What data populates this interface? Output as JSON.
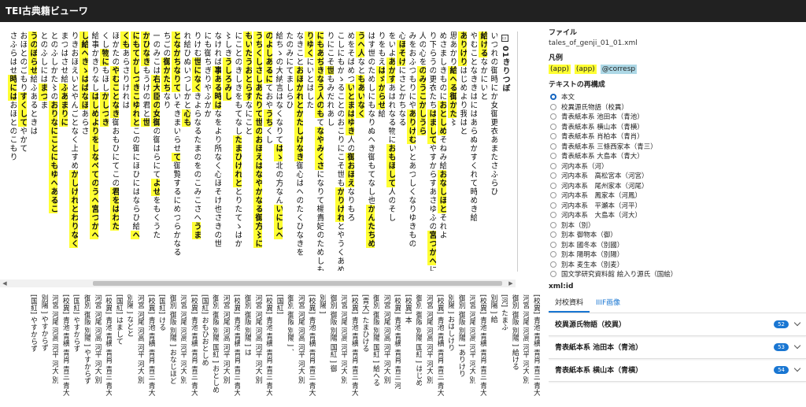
{
  "app": {
    "title": "TEI古典籍ビューワ"
  },
  "reader": {
    "chapter_title": "01きりつぼ",
    "columns": [
      [
        [
          "いつれの御時にか女御更衣あまたさふらひ",
          "n"
        ]
      ],
      [
        [
          "給ける",
          "h"
        ],
        [
          "なかにいと",
          "n"
        ]
      ],
      [
        [
          "やむことなききはにはあらぬかすくれて時めき給",
          "n"
        ]
      ],
      [
        [
          "ありけり",
          "h"
        ],
        [
          "はじめより我はと",
          "n"
        ]
      ],
      [
        [
          "思あかり",
          "n"
        ],
        [
          "給へる",
          "h"
        ],
        [
          "御かた",
          "h"
        ],
        [
          "〻",
          "n"
        ]
      ],
      [
        [
          "めさましきものに",
          "n"
        ],
        [
          "おとしめ",
          "h"
        ],
        [
          "そねみ給",
          "n"
        ],
        [
          "おなしほと",
          "h"
        ],
        [
          "それよ",
          "n"
        ]
      ],
      [
        [
          "り下らうの更衣たち",
          "n"
        ],
        [
          "はまして",
          "h"
        ],
        [
          "やすからすあさゆふの",
          "n"
        ],
        [
          "宮つかへ",
          "h"
        ],
        [
          "に",
          "n"
        ],
        [
          "つけても",
          "h"
        ]
      ],
      [
        [
          "人の心を",
          "n"
        ],
        [
          "のみ",
          "h"
        ],
        [
          "うこかし",
          "h"
        ],
        [
          "うら",
          "h"
        ]
      ],
      [
        [
          "みをおふつもりにや",
          "n"
        ],
        [
          "ありけむ",
          "h"
        ],
        [
          "いとあつしくなりゆき",
          "n"
        ],
        [
          "もの",
          "n"
        ]
      ],
      [
        [
          "心",
          "n"
        ],
        [
          "ほそけ",
          "h"
        ],
        [
          "にさとかちなる",
          "n"
        ]
      ],
      [
        [
          "をいよ",
          "n"
        ],
        [
          "あかす",
          "h"
        ],
        [
          "あはれなる物に",
          "n"
        ],
        [
          "おもほして",
          "h"
        ],
        [
          "人",
          "n"
        ],
        [
          "のそし",
          "n"
        ]
      ],
      [
        [
          "りをもえ",
          "n"
        ],
        [
          "はゞからせ",
          "h"
        ],
        [
          "給",
          "n"
        ]
      ],
      [
        [
          "はす世のためしにもなりぬへき御もてなし也",
          "n"
        ],
        [
          "かんたちめ",
          "h"
        ]
      ],
      [
        [
          "うへ人",
          "h"
        ],
        [
          "なと",
          "n"
        ],
        [
          "もあいなく",
          "h"
        ]
      ],
      [
        [
          "めをそばめつ",
          "n"
        ],
        [
          "いとまはゆき",
          "h"
        ],
        [
          "人の",
          "n"
        ],
        [
          "御",
          "h"
        ],
        [
          "おほえ",
          "h"
        ],
        [
          "なりもろ",
          "n"
        ]
      ],
      [
        [
          "こしにもかゝることのおこりにこそ世も",
          "n"
        ],
        [
          "かりけれ",
          "h"
        ],
        [
          "とやうくあめのした",
          "n"
        ]
      ],
      [
        [
          "りにこそ",
          "n"
        ],
        [
          "世",
          "h"
        ],
        [
          "もみだれあし",
          "n"
        ]
      ],
      [
        [
          "にもあぢきなう人のも",
          "h"
        ],
        [
          "て",
          "n"
        ],
        [
          "なやみくさ",
          "h"
        ],
        [
          "になりて楊貴妃のためしもひきいてつへく",
          "n"
        ],
        [
          "な",
          "h"
        ]
      ],
      [
        [
          "りゆく",
          "h"
        ],
        [
          "にいとはした",
          "n"
        ]
      ],
      [
        [
          "なきこと",
          "n"
        ],
        [
          "おほかれと",
          "h"
        ],
        [
          "かたしけなき",
          "h"
        ],
        [
          "御心はへのたくひなきを",
          "n"
        ]
      ],
      [
        [
          "たのみにてましらひ",
          "n"
        ]
      ],
      [
        [
          "給",
          "n"
        ],
        [
          "ちゝの大納言はなくなりて",
          "n"
        ],
        [
          "はゝ",
          "h"
        ],
        [
          "北の方なん",
          "n"
        ],
        [
          "いにしへ",
          "h"
        ]
      ],
      [
        [
          "のよしあるに",
          "h"
        ],
        [
          "て",
          "n"
        ],
        [
          "おや",
          "n"
        ],
        [
          "うち",
          "h"
        ],
        [
          "くし",
          "n"
        ]
      ],
      [
        [
          "うちくしさしあたりて世のおほえはなやか",
          "h"
        ],
        [
          "なる御方〻に",
          "h"
        ]
      ],
      [
        [
          "もいたう",
          "h"
        ],
        [
          "おとらす",
          "h"
        ],
        [
          "なにこと",
          "n"
        ]
      ],
      [
        [
          "にことのきしきをもてなし",
          "n"
        ],
        [
          "たまひけれと",
          "h"
        ],
        [
          "とりたてゝはか",
          "n"
        ]
      ],
      [
        [
          "〻しき",
          "n"
        ],
        [
          "うしろみし",
          "h"
        ]
      ],
      [
        [
          "なければ",
          "n"
        ],
        [
          "事ある時は",
          "h"
        ],
        [
          "なをより所なく心ほそけ也さきの世",
          "n"
        ]
      ],
      [
        [
          "にも御ちぎりやふかか",
          "n"
        ]
      ],
      [
        [
          "りけむ",
          "n"
        ],
        [
          "世になく",
          "h"
        ],
        [
          "きよらなるたまのをのこみこさへ",
          "n"
        ],
        [
          "うま",
          "h"
        ]
      ],
      [
        [
          "れ給ひぬいつしかと",
          "n"
        ],
        [
          "心も",
          "h"
        ]
      ],
      [
        [
          "となかちなりて",
          "h"
        ],
        [
          "いそきまいらせ",
          "n"
        ],
        [
          "て",
          "h"
        ],
        [
          "御覧するにめつらかなる",
          "n"
        ]
      ],
      [
        [
          "ちごの",
          "n"
        ],
        [
          "御かたち",
          "h"
        ],
        [
          "なり",
          "n"
        ]
      ],
      [
        [
          "一のみこは",
          "n"
        ],
        [
          "右大臣の女御",
          "h"
        ],
        [
          "の御はらにて",
          "n"
        ],
        [
          "よせ",
          "h"
        ],
        [
          "をもくうた",
          "n"
        ]
      ],
      [
        [
          "かひなき",
          "h"
        ],
        [
          "もうけの君と",
          "n"
        ],
        [
          "世",
          "h"
        ]
      ],
      [
        [
          "にもてかしつき",
          "h"
        ],
        [
          "こゆれと",
          "h"
        ],
        [
          "この御にほひにはならひ給",
          "n"
        ],
        [
          "へ",
          "h"
        ]
      ],
      [
        [
          "くも",
          "h"
        ],
        [
          "あらさりけれは",
          "n"
        ]
      ],
      [
        [
          "ほかたの",
          "n"
        ],
        [
          "やむことなき",
          "h"
        ],
        [
          "御おもひにてこの",
          "n"
        ],
        [
          "君をはわた",
          "h"
        ]
      ],
      [
        [
          "くし",
          "n"
        ],
        [
          "物に",
          "h"
        ],
        [
          "もほし",
          "n"
        ],
        [
          "かしつき",
          "h"
        ]
      ],
      [
        [
          "給事かきりなし",
          "n"
        ],
        [
          "はしめより",
          "h"
        ],
        [
          "をしなべての",
          "h"
        ],
        [
          "うへ宮つかへ",
          "h"
        ]
      ],
      [
        [
          "し給へき",
          "h"
        ],
        [
          "ゝはばなほ",
          "h"
        ],
        [
          "あらさ",
          "n"
        ]
      ],
      [
        [
          "りきおほえいとやんごとなく上すめ",
          "n"
        ],
        [
          "かしけれとわりなく",
          "h"
        ]
      ],
      [
        [
          "まつはさせ給",
          "n"
        ],
        [
          "ふあまりに",
          "h"
        ]
      ],
      [
        [
          "とのふしかた〻の",
          "n"
        ],
        [
          "おり",
          "h"
        ],
        [
          "なにことにも",
          "h"
        ],
        [
          "ゆへある",
          "h"
        ],
        [
          "こ",
          "h"
        ]
      ],
      [
        [
          "とのふしには",
          "n"
        ],
        [
          "まつ",
          "h"
        ],
        [
          "ま",
          "n"
        ]
      ],
      [
        [
          "うのぼらせ",
          "h"
        ],
        [
          "給ふあるときは",
          "n"
        ]
      ],
      [
        [
          "おほとのごもり",
          "n"
        ],
        [
          "すくして",
          "h"
        ],
        [
          "やかて",
          "n"
        ]
      ],
      [
        [
          "さふらはせ",
          "n"
        ],
        [
          "時には",
          "h"
        ],
        [
          "おほとのこもり",
          "n"
        ]
      ]
    ]
  },
  "variants": {
    "columns": [
      "[校異] 青池 青横 青肖 青三 青大",
      "河宮 河尾 河高 河平 河大 別",
      "御別 御阪 別陽 ] 給ける",
      "[河] たまふ",
      "別陽 ] 給",
      "[校異] 青池 青横 青肖 青三 青大",
      "河宮 河尾 河高 河平 河大 別",
      "御別 御阪 別陽 ] ありけり",
      "別陽 ] おはしけり",
      "[校異] 青池 青横 青肖 青三 青大",
      "河宮 河尾 河高 河平 河大 別",
      "御別 御阪 別陽 国紅 ] はじめ",
      "[校異] 本",
      "[校異] 青池 青横 青肖 青三 河",
      "河宮 河尾 河高 河平 河大 別",
      "御別 御阪 別陽 国紅 ] 給へる",
      "[青大] たまひける",
      "[校異] 青池 青横 青肖 青三 青大",
      "河宮 河尾 河高 河平 河大 別",
      "御別 御阪 別陽 国紅 ] 御",
      "別陽 ]",
      "[校異] 青池 青横 青肖 青三 青大",
      "河宮 河尾 河高 河平 河大 別",
      "御別 御阪 別陽 ] 、",
      "[国紅]",
      "[校異] 青池 青横 青肖 青三 青大",
      "河宮 河尾 河高 河平 河大 別",
      "御別 御阪 別陽 ] は",
      "[校異] 青池 青横 青肖 青三 青大",
      "河宮 河尾 河高 河平 河大 別",
      "御別 御阪 別陽 国紅 ] おとしめ",
      "[国紅] おもひおとしめ",
      "[校異] 青池 青横 青肖 青三 青大",
      "河宮 河尾 河高 河平 河大 別",
      "御別 御阪 別陽 ] おなじほど",
      "[国紅] ける",
      "[校異] 青池 青横 青肖 青三 青大",
      "河宮 河尾 河高 河平 河大 別",
      "別陽 ] などと",
      "[国紅] はまして",
      "[校異] 青池 青横 青肖 青三 青大",
      "河宮 河尾 河高 河平 河大 別",
      "御別 御阪 別陽 ] やすからず",
      "[国紅] やすからず",
      "[校異] 青池 青横 青肖 青三 青大",
      "河宮 河尾 河高 河平 河大 別",
      "別陽 ] やすからず",
      "[国紅] やすからず"
    ]
  },
  "side": {
    "file_heading": "ファイル",
    "file_name": "tales_of_genji_01_01.xml",
    "legend_heading": "凡例",
    "legend": [
      "(app)",
      "(app)",
      "@corresp"
    ],
    "reconstruct_heading": "テキストの再構成",
    "options": [
      {
        "label": "本文",
        "checked": true
      },
      {
        "label": "校異源氏物語（校異）",
        "checked": false
      },
      {
        "label": "青表紙本系 池田本（青池）",
        "checked": false
      },
      {
        "label": "青表紙本系 横山本（青横）",
        "checked": false
      },
      {
        "label": "青表紙本系 肖柏本（青肖）",
        "checked": false
      },
      {
        "label": "青表紙本系 三條西家本（青三）",
        "checked": false
      },
      {
        "label": "青表紙本系 大島本（青大）",
        "checked": false
      },
      {
        "label": "河内本系（河）",
        "checked": false
      },
      {
        "label": "河内本系　高松宮本（河宮）",
        "checked": false
      },
      {
        "label": "河内本系　尾州家本（河尾）",
        "checked": false
      },
      {
        "label": "河内本系　鳳家本（河鳳）",
        "checked": false
      },
      {
        "label": "河内本系　平瀬本（河平）",
        "checked": false
      },
      {
        "label": "河内本系　大島本（河大）",
        "checked": false
      },
      {
        "label": "別本（別）",
        "checked": false
      },
      {
        "label": "別本 御物本（御）",
        "checked": false
      },
      {
        "label": "別本 國冬本（別國）",
        "checked": false
      },
      {
        "label": "別本 陽明本（別陽）",
        "checked": false
      },
      {
        "label": "別本 麦生本（別麦）",
        "checked": false
      },
      {
        "label": "国文学研究資料館 絵入り源氏（国絵）",
        "checked": false
      }
    ],
    "xmlid_label": "xml:id",
    "tabs": [
      "対校資料",
      "IIIF画像"
    ],
    "panels": [
      {
        "label": "校異源氏物語（校異）",
        "count": "52"
      },
      {
        "label": "青表紙本系 池田本（青池）",
        "count": "53"
      },
      {
        "label": "青表紙本系 横山本（青横）",
        "count": "54"
      }
    ]
  },
  "colors": {
    "appbar": "#212121",
    "highlight": "#ffff33",
    "accent": "#1976d2",
    "corresp": "#add8e6"
  }
}
